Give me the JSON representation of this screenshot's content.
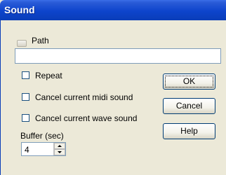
{
  "window": {
    "title": "Sound"
  },
  "path": {
    "label": "Path",
    "value": ""
  },
  "options": {
    "repeat": {
      "label": "Repeat",
      "checked": false
    },
    "cancel_midi": {
      "label": "Cancel current midi sound",
      "checked": false
    },
    "cancel_wave": {
      "label": "Cancel current wave sound",
      "checked": false
    }
  },
  "buffer": {
    "label": "Buffer (sec)",
    "value": "4"
  },
  "buttons": {
    "ok": "OK",
    "cancel": "Cancel",
    "help": "Help"
  }
}
